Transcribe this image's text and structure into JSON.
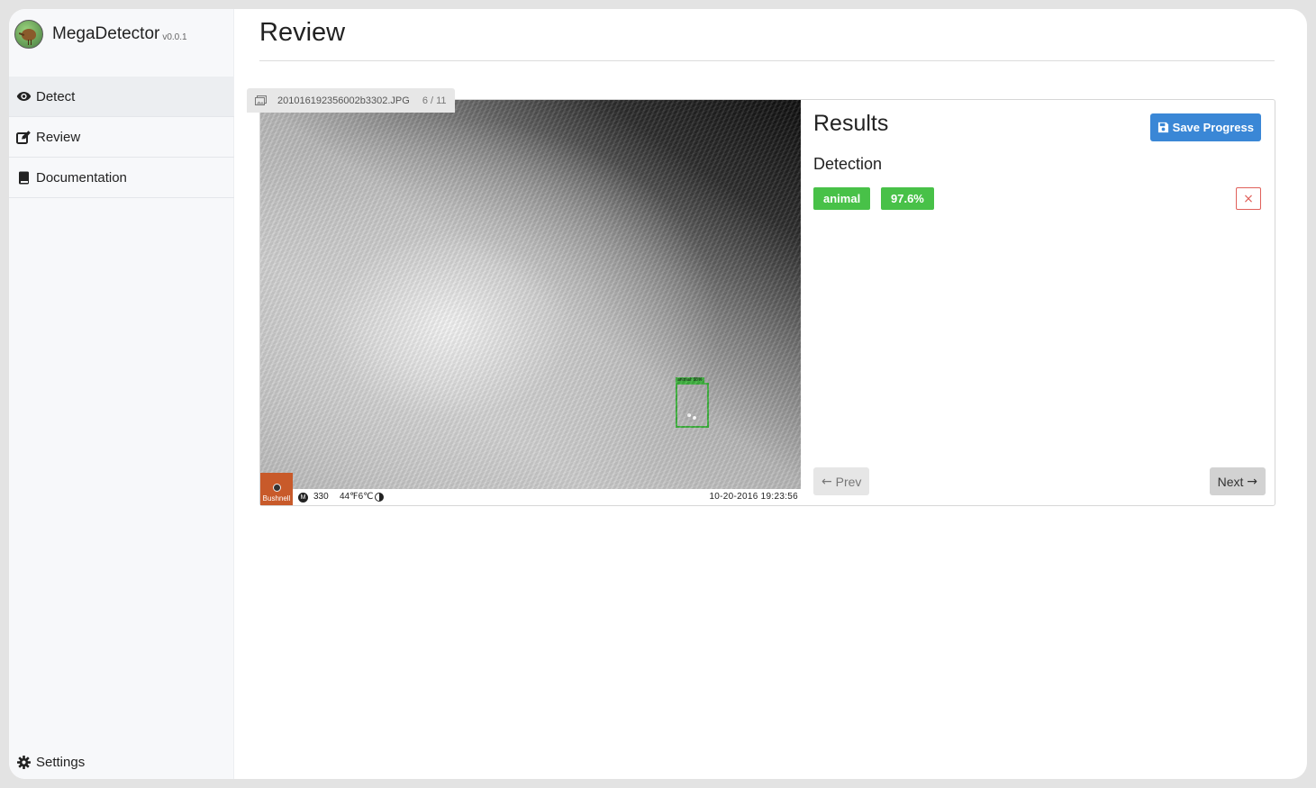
{
  "app": {
    "name": "MegaDetector",
    "version": "v0.0.1"
  },
  "sidebar": {
    "items": [
      {
        "label": "Detect",
        "icon": "eye-icon",
        "active": true
      },
      {
        "label": "Review",
        "icon": "edit-icon",
        "active": false
      },
      {
        "label": "Documentation",
        "icon": "book-icon",
        "active": false
      }
    ],
    "settings_label": "Settings"
  },
  "page": {
    "title": "Review"
  },
  "viewer": {
    "filename": "201016192356002b3302.JPG",
    "counter": "6 / 11",
    "progress": 0.4545,
    "box_label": "animal: 98%",
    "camera": {
      "brand": "Bushnell",
      "badge": "M",
      "number": "330",
      "temperature": "44℉6℃",
      "datetime": "10-20-2016  19:23:56"
    }
  },
  "results": {
    "title": "Results",
    "save_label": "Save Progress",
    "detection_title": "Detection",
    "detection": {
      "label": "animal",
      "confidence": "97.6%"
    },
    "remove_label": "×",
    "prev_label": "Prev",
    "next_label": "Next"
  },
  "colors": {
    "accent": "#3a87d6",
    "success": "#48c148",
    "danger": "#e0605a"
  }
}
